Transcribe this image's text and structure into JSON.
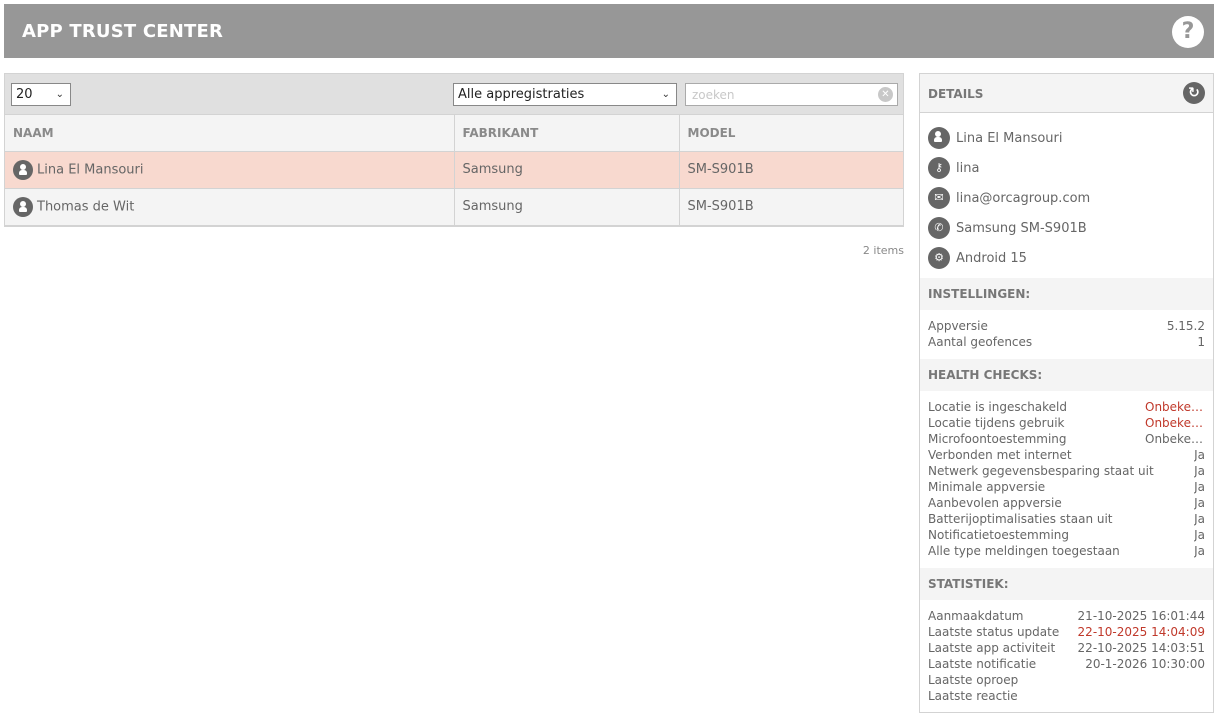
{
  "header": {
    "title": "APP TRUST CENTER",
    "help_label": "?"
  },
  "toolbar": {
    "page_size": "20",
    "filter": "Alle appregistraties",
    "search_placeholder": "zoeken",
    "search_value": ""
  },
  "table": {
    "columns": [
      "NAAM",
      "FABRIKANT",
      "MODEL"
    ],
    "rows": [
      {
        "name": "Lina El Mansouri",
        "manufacturer": "Samsung",
        "model": "SM-S901B"
      },
      {
        "name": "Thomas de Wit",
        "manufacturer": "Samsung",
        "model": "SM-S901B"
      }
    ],
    "item_count": "2 items"
  },
  "details": {
    "title": "DETAILS",
    "info": {
      "name": "Lina El Mansouri",
      "username": "lina",
      "email": "lina@orcagroup.com",
      "device": "Samsung SM-S901B",
      "os": "Android 15"
    },
    "settings": {
      "title": "INSTELLINGEN:",
      "items": [
        {
          "label": "Appversie",
          "value": "5.15.2"
        },
        {
          "label": "Aantal geofences",
          "value": "1"
        }
      ]
    },
    "health": {
      "title": "HEALTH CHECKS:",
      "items": [
        {
          "label": "Locatie is ingeschakeld",
          "value": "Onbekend"
        },
        {
          "label": "Locatie tijdens gebruik",
          "value": "Onbekend"
        },
        {
          "label": "Microfoontoestemming",
          "value": "Onbekend"
        },
        {
          "label": "Verbonden met internet",
          "value": "Ja"
        },
        {
          "label": "Netwerk gegevensbesparing staat uit",
          "value": "Ja"
        },
        {
          "label": "Minimale appversie",
          "value": "Ja"
        },
        {
          "label": "Aanbevolen appversie",
          "value": "Ja"
        },
        {
          "label": "Batterijoptimalisaties staan uit",
          "value": "Ja"
        },
        {
          "label": "Notificatietoestemming",
          "value": "Ja"
        },
        {
          "label": "Alle type meldingen toegestaan",
          "value": "Ja"
        }
      ]
    },
    "stats": {
      "title": "STATISTIEK:",
      "items": [
        {
          "label": "Aanmaakdatum",
          "value": "21-10-2025 16:01:44"
        },
        {
          "label": "Laatste status update",
          "value": "22-10-2025 14:04:09"
        },
        {
          "label": "Laatste app activiteit",
          "value": "22-10-2025 14:03:51"
        },
        {
          "label": "Laatste notificatie",
          "value": "20-1-2026 10:30:00"
        },
        {
          "label": "Laatste oproep",
          "value": ""
        },
        {
          "label": "Laatste reactie",
          "value": ""
        }
      ]
    }
  },
  "colors": {
    "header": "#979797",
    "selected_row": "#f8d9cf",
    "warning_text": "#c0392b"
  }
}
